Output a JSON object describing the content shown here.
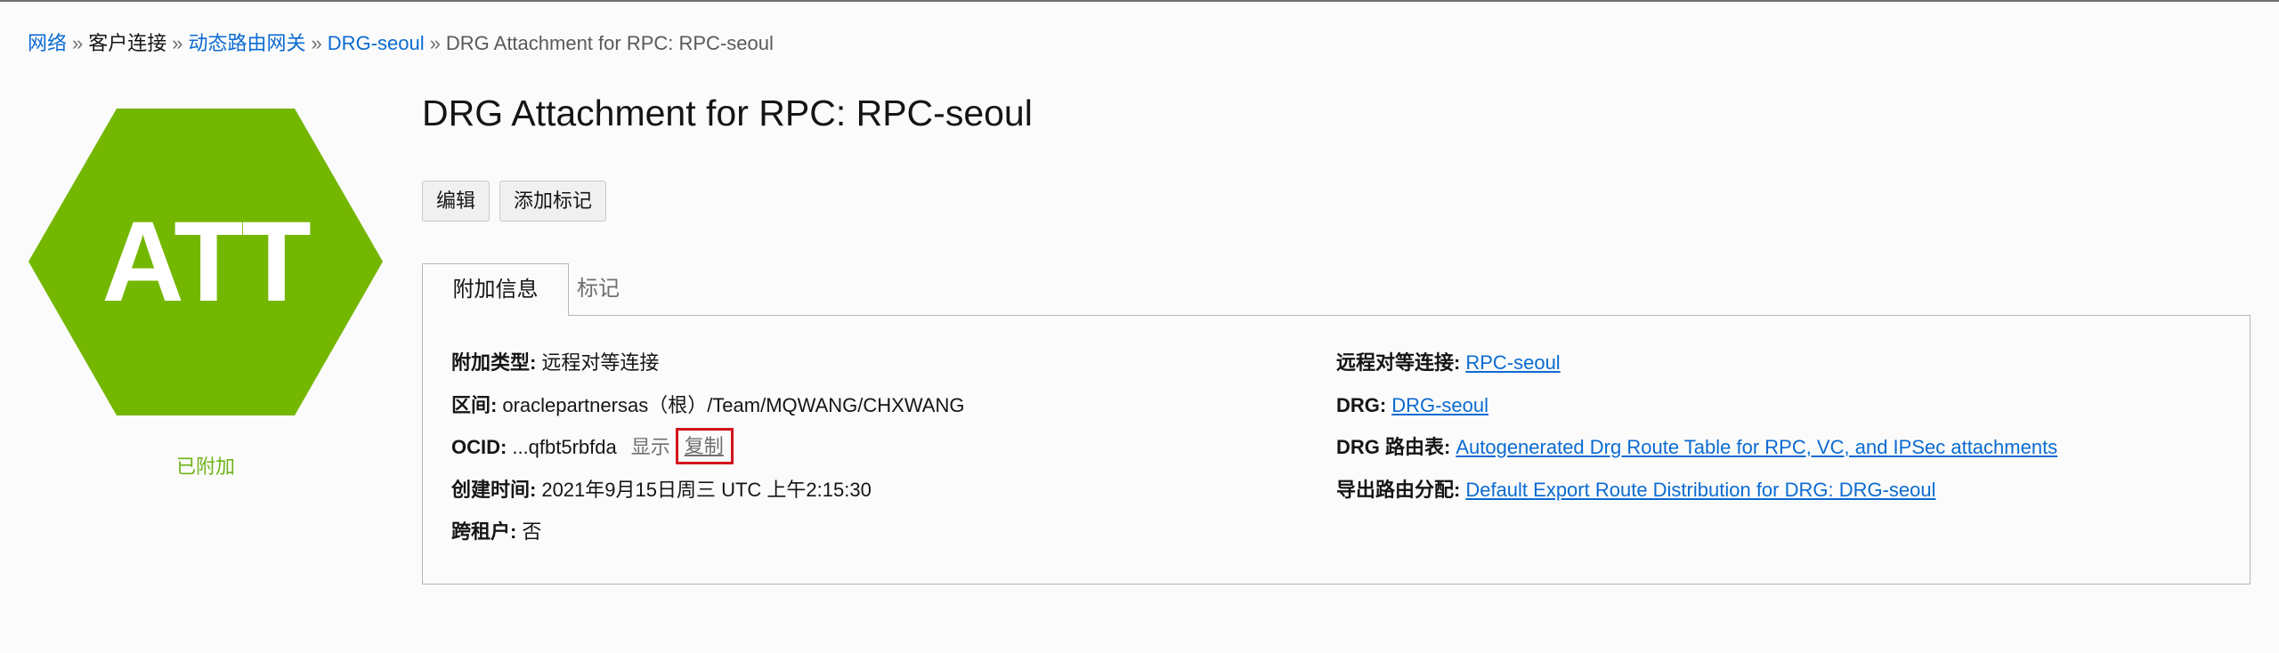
{
  "breadcrumb": [
    {
      "label": "网络",
      "link": true
    },
    {
      "label": "客户连接",
      "link": false
    },
    {
      "label": "动态路由网关",
      "link": true
    },
    {
      "label": "DRG-seoul",
      "link": true
    },
    {
      "label": "DRG Attachment for RPC: RPC-seoul",
      "link": false
    }
  ],
  "badge": {
    "text": "ATT",
    "color": "#74b700",
    "status": "已附加",
    "status_color": "#6fb31a"
  },
  "page_title": "DRG Attachment for RPC: RPC-seoul",
  "actions": {
    "edit": "编辑",
    "add_tags": "添加标记"
  },
  "tabs": {
    "info": "附加信息",
    "tags": "标记"
  },
  "details_left": {
    "attachment_type": {
      "label": "附加类型:",
      "value": "远程对等连接"
    },
    "compartment": {
      "label": "区间:",
      "value": "oraclepartnersas（根）/Team/MQWANG/CHXWANG"
    },
    "ocid": {
      "label": "OCID:",
      "value": "...qfbt5rbfda",
      "show": "显示",
      "copy": "复制"
    },
    "created": {
      "label": "创建时间:",
      "value": "2021年9月15日周三 UTC 上午2:15:30"
    },
    "cross_tenancy": {
      "label": "跨租户:",
      "value": "否"
    }
  },
  "details_right": {
    "rpc": {
      "label": "远程对等连接:",
      "value": "RPC-seoul"
    },
    "drg": {
      "label": "DRG:",
      "value": "DRG-seoul"
    },
    "route_table": {
      "label": "DRG 路由表:",
      "value": "Autogenerated Drg Route Table for RPC, VC, and IPSec attachments"
    },
    "export_distribution": {
      "label": "导出路由分配:",
      "value": "Default Export Route Distribution for DRG: DRG-seoul"
    }
  },
  "colors": {
    "link": "#0b6bd1",
    "highlight_box": "#d5141c",
    "accent_green": "#74b700"
  }
}
